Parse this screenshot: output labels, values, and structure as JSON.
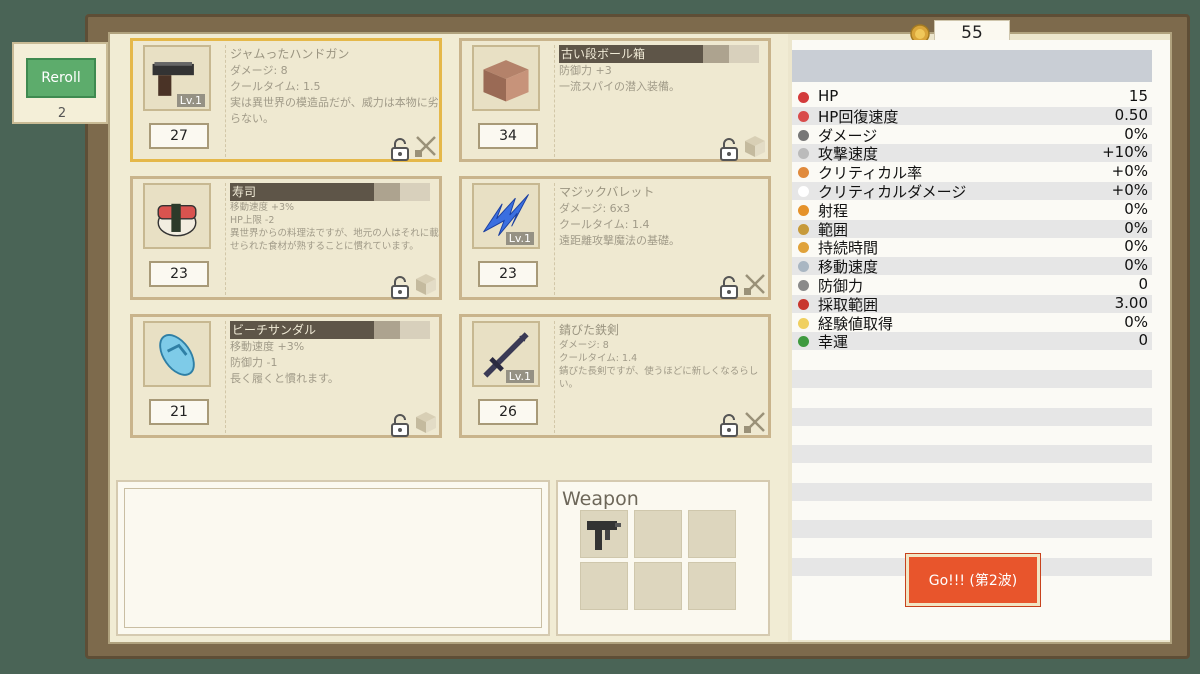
{
  "gold": "55",
  "reroll": {
    "label": "Reroll",
    "count": "2"
  },
  "cards": [
    {
      "name": "ジャムったハンドガン",
      "lines": "ダメージ: 8\nクールタイム: 1.5\n実は異世界の模造品だが、威力は本物に劣らない。",
      "price": "27",
      "level": "Lv.1",
      "icon": "handgun-icon",
      "type_icon": "weapon-type-icon",
      "selected": true,
      "bar": false,
      "small": false
    },
    {
      "name": "古い段ボール箱",
      "lines": "防御力 +3\n一流スパイの潜入装備。",
      "price": "34",
      "level": "",
      "icon": "cardboard-box-icon",
      "type_icon": "item-type-icon",
      "selected": false,
      "bar": true,
      "small": false
    },
    {
      "name": "寿司",
      "lines": "移動速度 +3%\nHP上限 -2\n異世界からの料理法ですが、地元の人はそれに載せられた食材が熟することに慣れています。",
      "price": "23",
      "level": "",
      "icon": "sushi-icon",
      "type_icon": "item-type-icon",
      "selected": false,
      "bar": true,
      "small": true
    },
    {
      "name": "マジックバレット",
      "lines": "ダメージ: 6x3\nクールタイム: 1.4\n遠距離攻撃魔法の基礎。",
      "price": "23",
      "level": "Lv.1",
      "icon": "magic-bullet-icon",
      "type_icon": "weapon-type-icon",
      "selected": false,
      "bar": false,
      "small": false
    },
    {
      "name": "ビーチサンダル",
      "lines": "移動速度 +3%\n防御力 -1\n長く履くと慣れます。",
      "price": "21",
      "level": "",
      "icon": "beach-sandal-icon",
      "type_icon": "item-type-icon",
      "selected": false,
      "bar": true,
      "small": false
    },
    {
      "name": "錆びた鉄剣",
      "lines": "ダメージ: 8\nクールタイム: 1.4\n錆びた長剣ですが、使うほどに新しくなるらしい。",
      "price": "26",
      "level": "Lv.1",
      "icon": "rusty-sword-icon",
      "type_icon": "weapon-type-icon",
      "selected": false,
      "bar": false,
      "small": true
    }
  ],
  "weapon_panel": {
    "title": "Weapon",
    "slots": [
      "smg-icon",
      "",
      "",
      "",
      "",
      ""
    ]
  },
  "stats": [
    {
      "label": "HP",
      "value": "15",
      "icon": "heart-icon",
      "color": "#d33b3b"
    },
    {
      "label": "HP回復速度",
      "value": "0.50",
      "icon": "regen-icon",
      "color": "#d94c4c"
    },
    {
      "label": "ダメージ",
      "value": "0%",
      "icon": "sword-icon",
      "color": "#777777"
    },
    {
      "label": "攻撃速度",
      "value": "+10%",
      "icon": "hourglass-icon",
      "color": "#bbbbbb"
    },
    {
      "label": "クリティカル率",
      "value": "+0%",
      "icon": "crit-icon",
      "color": "#e08a3c"
    },
    {
      "label": "クリティカルダメージ",
      "value": "+0%",
      "icon": "blank-icon",
      "color": "#ffffff"
    },
    {
      "label": "射程",
      "value": "0%",
      "icon": "range-icon",
      "color": "#e5922a"
    },
    {
      "label": "範囲",
      "value": "0%",
      "icon": "area-icon",
      "color": "#c79a3a"
    },
    {
      "label": "持続時間",
      "value": "0%",
      "icon": "clock-icon",
      "color": "#e0a23a"
    },
    {
      "label": "移動速度",
      "value": "0%",
      "icon": "wing-icon",
      "color": "#a9b6c2"
    },
    {
      "label": "防御力",
      "value": "0",
      "icon": "shield-icon",
      "color": "#8a8a8a"
    },
    {
      "label": "採取範囲",
      "value": "3.00",
      "icon": "magnet-icon",
      "color": "#c8362e"
    },
    {
      "label": "経験値取得",
      "value": "0%",
      "icon": "bulb-icon",
      "color": "#f0d060"
    },
    {
      "label": "幸運",
      "value": "0",
      "icon": "clover-icon",
      "color": "#3f9a3f"
    }
  ],
  "go_button": {
    "label": "Go!!! (第2波)"
  }
}
